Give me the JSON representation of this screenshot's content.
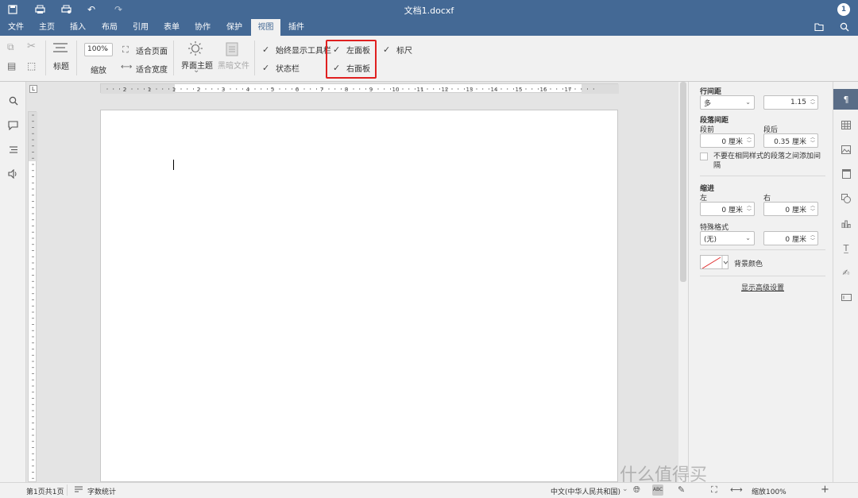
{
  "titlebar": {
    "title": "文档1.docxf",
    "avatar": "1",
    "icons": [
      "save-icon",
      "print-icon",
      "quick-print-icon",
      "undo-icon",
      "redo-icon"
    ]
  },
  "menu": {
    "tabs": [
      "文件",
      "主页",
      "插入",
      "布局",
      "引用",
      "表单",
      "协作",
      "保护",
      "视图",
      "插件"
    ],
    "active_tab": "视图"
  },
  "toolbar": {
    "heading_label": "标题",
    "zoom_value": "100%",
    "zoom_label": "缩放",
    "fit_page": "适合页面",
    "fit_width": "适合宽度",
    "theme_label": "界面主题",
    "dark_doc_label": "黑暗文件",
    "always_show_toolbar": "始终显示工具栏",
    "status_bar": "状态栏",
    "left_panel": "左面板",
    "right_panel": "右面板",
    "ruler": "标尺"
  },
  "ruler": {
    "ticks": [
      "2",
      "1",
      "1",
      "2",
      "3",
      "4",
      "5",
      "6",
      "7",
      "8",
      "9",
      "10",
      "11",
      "12",
      "13",
      "14",
      "15",
      "16",
      "17"
    ]
  },
  "right_panel": {
    "line_spacing_title": "行间距",
    "line_spacing_mode": "多",
    "line_spacing_value": "1.15",
    "para_spacing_title": "段落间距",
    "before_label": "段前",
    "after_label": "段后",
    "before_value": "0 厘米",
    "after_value": "0.35 厘米",
    "no_spacing_same_style": "不要在相同样式的段落之间添加间隔",
    "indent_title": "缩进",
    "left_label": "左",
    "right_label": "右",
    "left_value": "0 厘米",
    "right_value": "0 厘米",
    "special_format_label": "特殊格式",
    "special_format_value": "(无)",
    "special_value": "0 厘米",
    "bg_color_label": "背景颜色",
    "show_advanced": "显示高级设置"
  },
  "statusbar": {
    "page_info": "第1页共1页",
    "word_count": "字数统计",
    "language": "中文(中华人民共和国)",
    "zoom": "缩放100%"
  },
  "watermark": "什么值得买"
}
